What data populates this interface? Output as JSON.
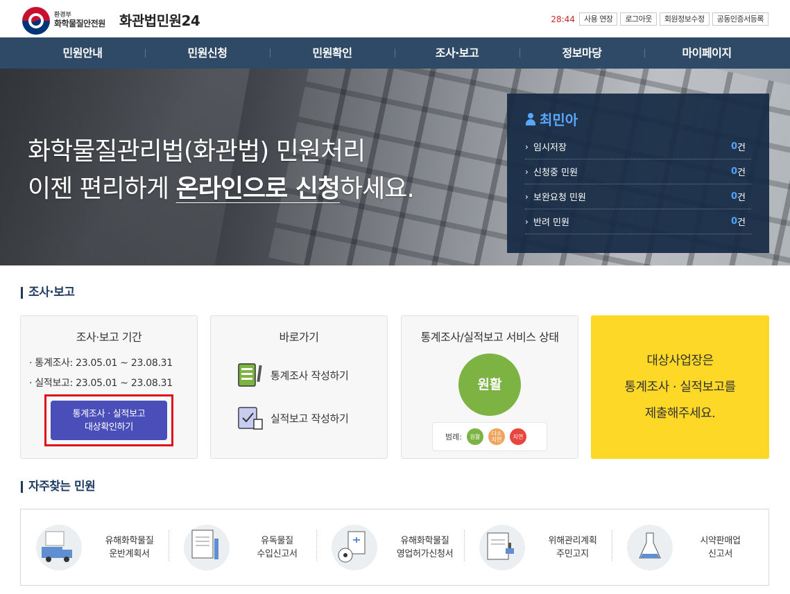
{
  "header": {
    "ministry": "환경부",
    "org": "화학물질안전원",
    "site_title": "화관법민원24",
    "timer": "28:44",
    "buttons": [
      "사용 연장",
      "로그아웃",
      "회원정보수정",
      "공동인증서등록"
    ]
  },
  "nav": [
    "민원안내",
    "민원신청",
    "민원확인",
    "조사·보고",
    "정보마당",
    "마이페이지"
  ],
  "hero": {
    "line1": "화학물질관리법(화관법) 민원처리",
    "line2_pre": "이젠 편리하게 ",
    "line2_bold": "온라인으로 신청",
    "line2_post": "하세요."
  },
  "user_panel": {
    "name": "최민아",
    "unit": "건",
    "stats": [
      {
        "label": "임시저장",
        "count": "0"
      },
      {
        "label": "신청중 민원",
        "count": "0"
      },
      {
        "label": "보완요청 민원",
        "count": "0"
      },
      {
        "label": "반려 민원",
        "count": "0"
      }
    ]
  },
  "section_survey": {
    "title": "조사·보고",
    "period_card": {
      "title": "조사·보고 기간",
      "lines": [
        "· 통계조사: 23.05.01 ~ 23.08.31",
        "· 실적보고: 23.05.01 ~ 23.08.31"
      ],
      "button_line1": "통계조사 · 실적보고",
      "button_line2": "대상확인하기"
    },
    "shortcut_card": {
      "title": "바로가기",
      "links": [
        "통계조사 작성하기",
        "실적보고 작성하기"
      ]
    },
    "status_card": {
      "title": "통계조사/실적보고 서비스 상태",
      "status": "원활",
      "legend_label": "범례:",
      "legend": [
        {
          "label": "원활",
          "color": "#7cb342"
        },
        {
          "label": "다소 지연",
          "color": "#f0a35a"
        },
        {
          "label": "지연",
          "color": "#e8453c"
        }
      ]
    },
    "notice": {
      "lines": [
        "대상사업장은",
        "통계조사 · 실적보고를",
        "제출해주세요."
      ],
      "color": "#fdd826"
    }
  },
  "section_frequent": {
    "title": "자주찾는 민원",
    "items": [
      {
        "line1": "유해화학물질",
        "line2": "운반계획서",
        "icon": "truck-icon"
      },
      {
        "line1": "유독물질",
        "line2": "수입신고서",
        "icon": "document-pen-icon"
      },
      {
        "line1": "유해화학물질",
        "line2": "영업허가신청서",
        "icon": "chemical-flask-icon"
      },
      {
        "line1": "위해관리계획",
        "line2": "주민고지",
        "icon": "stamp-document-icon"
      },
      {
        "line1": "시약판매업",
        "line2": "신고서",
        "icon": "beaker-icon"
      }
    ]
  },
  "colors": {
    "nav_bg": "#2f4a67",
    "panel_bg": "#162a44",
    "accent_blue": "#4ea3ff",
    "cta_purple": "#4a4eb8",
    "highlight_red": "#e0101a"
  }
}
